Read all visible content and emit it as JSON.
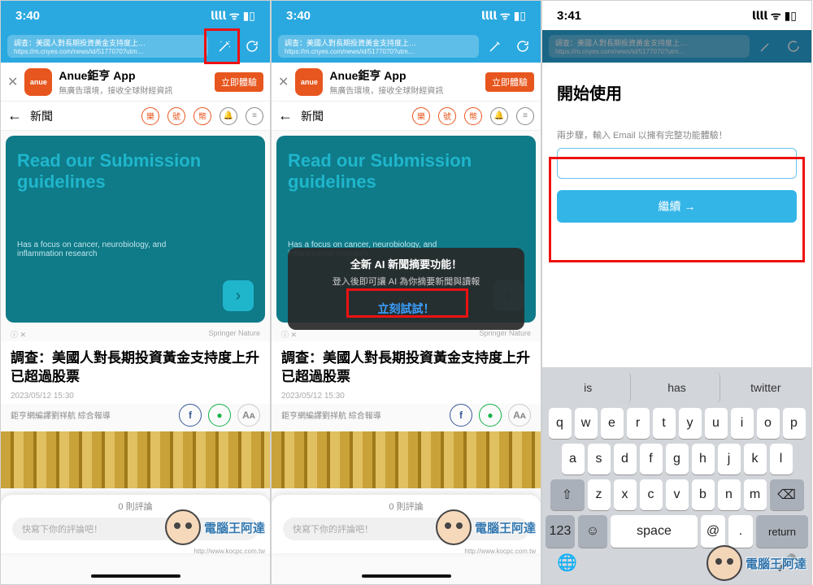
{
  "status": {
    "time1": "3:40",
    "time2": "3:40",
    "time3": "3:41",
    "signal": "𝗹𝗹𝗹𝗹 ᯤ ▮▯"
  },
  "url": {
    "title": "調查：美國人對長期投資黃金支持度上…",
    "href": "https://m.cnyes.com/news/id/5177070?utm…"
  },
  "banner": {
    "close": "✕",
    "logo": "anue",
    "title": "Anue鉅亨 App",
    "subtitle": "無廣告環境，接收全球財經資訊",
    "cta": "立即體驗"
  },
  "nav": {
    "back": "←",
    "title": "新聞",
    "i1": "樂",
    "i2": "號",
    "i3": "幣"
  },
  "card": {
    "title": "Read our Submission guidelines",
    "sub": "Has a focus on cancer, neurobiology, and inflammation research",
    "arrow": "›"
  },
  "ad": {
    "left": "ⓘ ✕",
    "right": "Springer Nature"
  },
  "article": {
    "title": "調查：美國人對長期投資黃金支持度上升 已超過股票",
    "date": "2023/05/12 15:30",
    "source": "鉅亨網編譯劉祥航 綜合報導",
    "aa": "Aᴀ"
  },
  "comments": {
    "count": "0 則評論",
    "placeholder": "快寫下你的評論吧！"
  },
  "tooltip": {
    "t": "全新 AI 新聞摘要功能！",
    "s": "登入後即可讓 AI 為你摘要新聞與讀報",
    "a": "立刻試試！"
  },
  "sheet": {
    "title": "開始使用",
    "label": "兩步驟，輸入 Email 以擁有完整功能體驗！",
    "value": "",
    "button": "繼續 →"
  },
  "kb": {
    "sug": [
      "is",
      "has",
      "twitter"
    ],
    "r1": [
      "q",
      "w",
      "e",
      "r",
      "t",
      "y",
      "u",
      "i",
      "o",
      "p"
    ],
    "r2": [
      "a",
      "s",
      "d",
      "f",
      "g",
      "h",
      "j",
      "k",
      "l"
    ],
    "r3": [
      "z",
      "x",
      "c",
      "v",
      "b",
      "n",
      "m"
    ],
    "shift": "⇧",
    "del": "⌫",
    "num": "123",
    "emoji": "☺︎",
    "space": "space",
    "at": "@",
    "dot": ".",
    "ret": "return"
  },
  "watermark": {
    "text": "電腦王阿達",
    "url": "http://www.kocpc.com.tw"
  }
}
